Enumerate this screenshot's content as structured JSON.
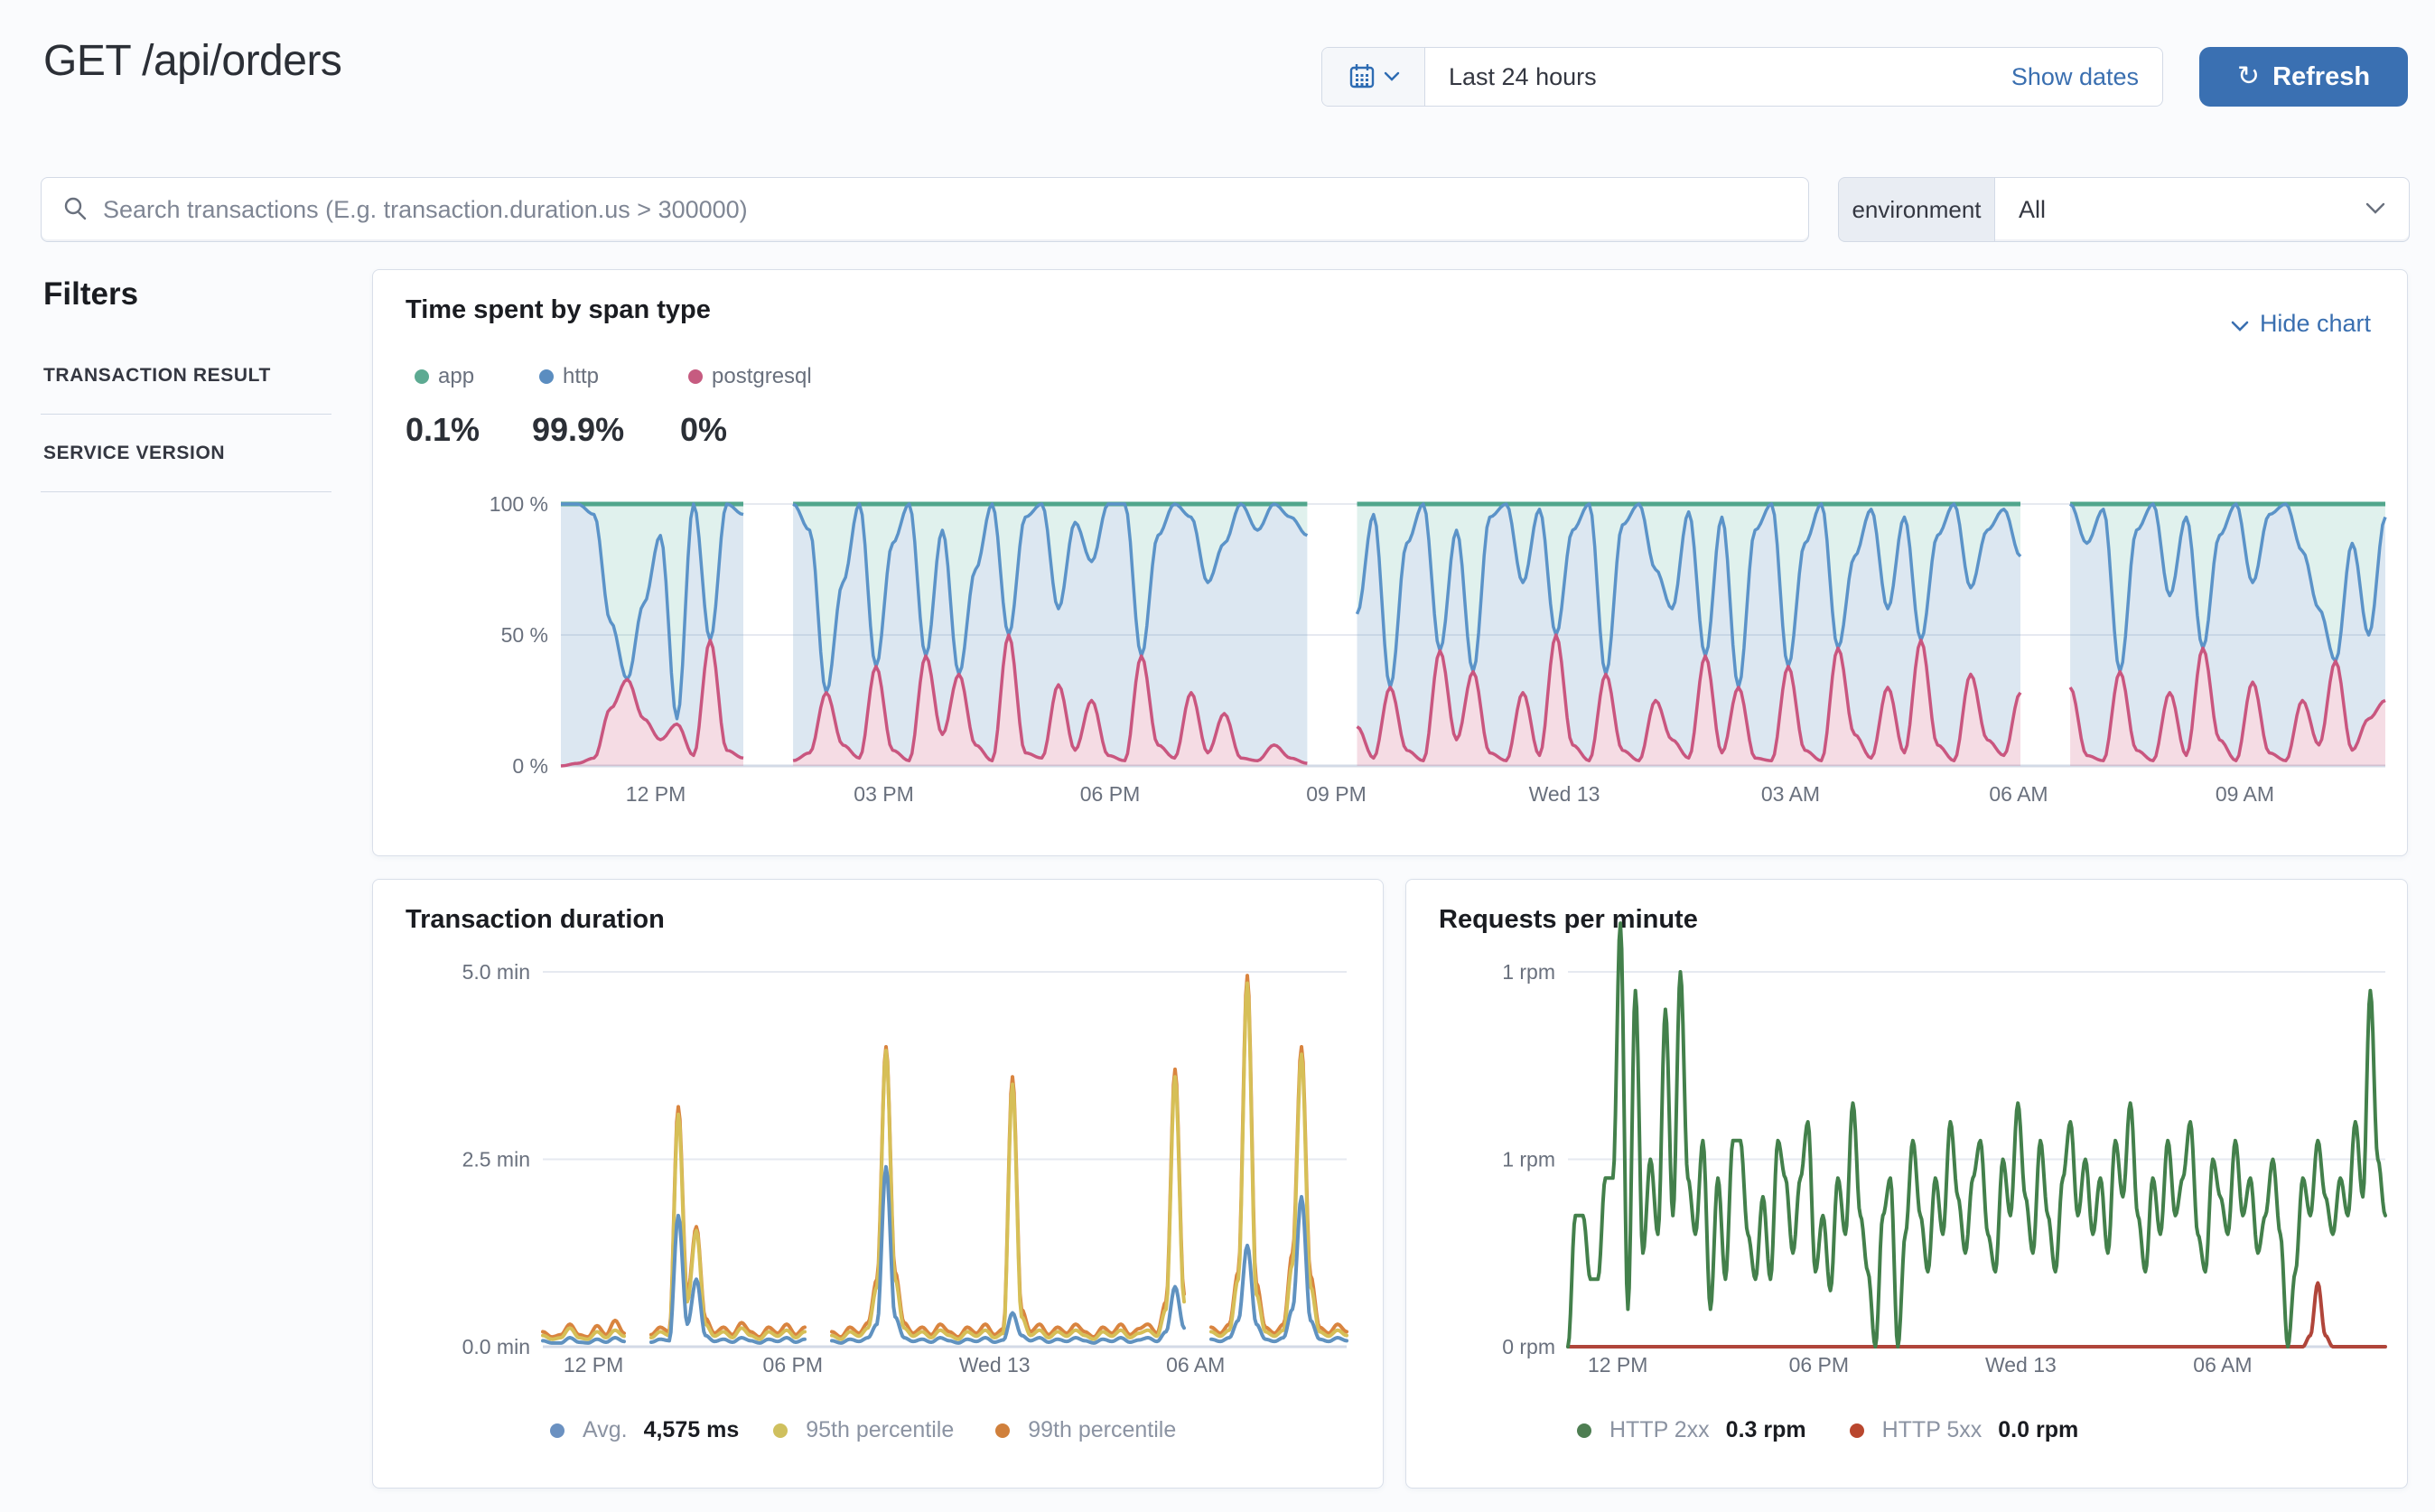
{
  "page": {
    "title": "GET /api/orders"
  },
  "datepicker": {
    "value": "Last 24 hours",
    "show_dates_label": "Show dates",
    "refresh_label": "Refresh",
    "refresh_icon_glyph": "↻",
    "accent_color": "#2e6cb3"
  },
  "search": {
    "placeholder": "Search transactions (E.g. transaction.duration.us > 300000)"
  },
  "environment": {
    "label": "environment",
    "value": "All"
  },
  "filters": {
    "title": "Filters",
    "sections": [
      {
        "label": "TRANSACTION RESULT"
      },
      {
        "label": "SERVICE VERSION"
      }
    ]
  },
  "span_card": {
    "title": "Time spent by span type",
    "hide_chart_label": "Hide chart",
    "legend": [
      {
        "label": "app",
        "pct": "0.1%",
        "color": "#5daa92"
      },
      {
        "label": "http",
        "pct": "99.9%",
        "color": "#5b8dc0"
      },
      {
        "label": "postgresql",
        "pct": "0%",
        "color": "#c65b80"
      }
    ]
  },
  "duration_card": {
    "title": "Transaction duration",
    "legend": [
      {
        "label": "Avg.",
        "value": "4,575 ms",
        "color": "#6b91c1"
      },
      {
        "label": "95th percentile",
        "value": "",
        "color": "#cfc05e"
      },
      {
        "label": "99th percentile",
        "value": "",
        "color": "#d0803c"
      }
    ]
  },
  "rpm_card": {
    "title": "Requests per minute",
    "legend": [
      {
        "label": "HTTP 2xx",
        "value": "0.3 rpm",
        "color": "#4e7e52"
      },
      {
        "label": "HTTP 5xx",
        "value": "0.0 rpm",
        "color": "#b9472e"
      }
    ]
  },
  "chart_data": [
    {
      "type": "area",
      "title": "Time spent by span type",
      "stacked_percent": true,
      "ylim": [
        0,
        100
      ],
      "grid": true,
      "yticks": [
        {
          "label": "100 %",
          "value": 100
        },
        {
          "label": "50 %",
          "value": 50
        },
        {
          "label": "0 %",
          "value": 0
        }
      ],
      "xticks": [
        {
          "label": "12 PM",
          "f": 0.052
        },
        {
          "label": "03 PM",
          "f": 0.177
        },
        {
          "label": "06 PM",
          "f": 0.301
        },
        {
          "label": "09 PM",
          "f": 0.425
        },
        {
          "label": "Wed 13",
          "f": 0.55
        },
        {
          "label": "03 AM",
          "f": 0.674
        },
        {
          "label": "06 AM",
          "f": 0.799
        },
        {
          "label": "09 AM",
          "f": 0.923
        }
      ],
      "series": [
        {
          "name": "postgresql",
          "color": "#c9567f",
          "fill": "rgba(211,96,134,0.22)",
          "values": [
            0,
            1,
            3,
            22,
            33,
            18,
            10,
            16,
            4,
            48,
            6,
            3,
            null,
            null,
            2,
            5,
            28,
            8,
            3,
            38,
            6,
            2,
            42,
            12,
            35,
            8,
            2,
            50,
            5,
            3,
            31,
            6,
            25,
            4,
            2,
            42,
            8,
            3,
            28,
            5,
            20,
            3,
            2,
            8,
            3,
            1,
            null,
            null,
            15,
            3,
            30,
            6,
            2,
            44,
            10,
            36,
            5,
            2,
            28,
            4,
            50,
            8,
            2,
            35,
            6,
            2,
            25,
            10,
            3,
            42,
            5,
            30,
            3,
            2,
            38,
            6,
            2,
            45,
            12,
            3,
            30,
            5,
            48,
            8,
            2,
            35,
            10,
            4,
            28,
            null,
            null,
            30,
            4,
            2,
            36,
            6,
            2,
            28,
            4,
            45,
            10,
            2,
            32,
            5,
            2,
            25,
            8,
            40,
            6,
            18,
            25
          ]
        },
        {
          "name": "http",
          "color": "#5b93c8",
          "fill": "rgba(96,146,192,0.22)",
          "values": [
            100,
            100,
            96,
            55,
            33,
            62,
            88,
            18,
            100,
            48,
            100,
            96,
            null,
            null,
            100,
            90,
            28,
            70,
            100,
            38,
            85,
            100,
            42,
            90,
            35,
            75,
            100,
            50,
            95,
            100,
            60,
            93,
            78,
            100,
            100,
            42,
            88,
            100,
            95,
            70,
            85,
            100,
            90,
            100,
            95,
            88,
            null,
            null,
            58,
            96,
            30,
            85,
            100,
            44,
            90,
            36,
            95,
            100,
            70,
            98,
            50,
            90,
            100,
            35,
            92,
            100,
            75,
            60,
            97,
            42,
            95,
            30,
            90,
            100,
            38,
            85,
            100,
            45,
            80,
            98,
            60,
            95,
            48,
            88,
            100,
            68,
            90,
            98,
            80,
            null,
            null,
            100,
            85,
            98,
            36,
            90,
            100,
            65,
            95,
            45,
            88,
            100,
            70,
            96,
            100,
            82,
            60,
            40,
            85,
            50,
            95
          ]
        },
        {
          "name": "app",
          "color": "#51a68c",
          "fill": "rgba(84,179,153,0.18)",
          "top_of_stack": 100
        }
      ]
    },
    {
      "type": "line",
      "title": "Transaction duration",
      "unit": "min",
      "ylim": [
        0,
        5.0
      ],
      "grid": true,
      "yticks": [
        {
          "label": "5.0 min",
          "value": 5
        },
        {
          "label": "2.5 min",
          "value": 2.5
        },
        {
          "label": "0.0 min",
          "value": 0
        }
      ],
      "xticks": [
        {
          "label": "12 PM",
          "f": 0.063
        },
        {
          "label": "06 PM",
          "f": 0.311
        },
        {
          "label": "Wed 13",
          "f": 0.562
        },
        {
          "label": "06 AM",
          "f": 0.812
        }
      ],
      "series": [
        {
          "name": "99th percentile",
          "color": "#d9843f",
          "values": [
            0.2,
            0.13,
            0.16,
            0.3,
            0.16,
            0.13,
            0.28,
            0.16,
            0.35,
            0.18,
            null,
            null,
            0.16,
            0.26,
            0.2,
            3.2,
            0.7,
            1.6,
            0.38,
            0.18,
            0.26,
            0.16,
            0.32,
            0.2,
            0.13,
            0.26,
            0.18,
            0.3,
            0.16,
            0.26,
            null,
            null,
            0.2,
            0.13,
            0.26,
            0.18,
            0.32,
            0.9,
            4.0,
            1.0,
            0.32,
            0.18,
            0.26,
            0.16,
            0.3,
            0.2,
            0.13,
            0.26,
            0.18,
            0.3,
            0.16,
            0.24,
            3.6,
            0.5,
            0.2,
            0.3,
            0.16,
            0.26,
            0.18,
            0.3,
            0.2,
            0.13,
            0.26,
            0.18,
            0.3,
            0.16,
            0.24,
            0.3,
            0.18,
            0.6,
            3.7,
            0.7,
            null,
            null,
            0.26,
            0.18,
            0.3,
            1.0,
            4.95,
            0.85,
            0.26,
            0.18,
            0.3,
            1.25,
            4.0,
            0.95,
            0.26,
            0.18,
            0.3,
            0.2
          ]
        },
        {
          "name": "95th percentile",
          "color": "#d6bf57",
          "values": [
            0.15,
            0.1,
            0.12,
            0.25,
            0.12,
            0.1,
            0.2,
            0.12,
            0.22,
            0.14,
            null,
            null,
            0.12,
            0.2,
            0.15,
            3.1,
            0.6,
            1.55,
            0.3,
            0.14,
            0.2,
            0.12,
            0.25,
            0.15,
            0.1,
            0.2,
            0.14,
            0.22,
            0.12,
            0.2,
            null,
            null,
            0.15,
            0.1,
            0.2,
            0.14,
            0.25,
            0.8,
            3.95,
            0.9,
            0.25,
            0.14,
            0.2,
            0.12,
            0.22,
            0.15,
            0.1,
            0.2,
            0.14,
            0.22,
            0.12,
            0.18,
            3.5,
            0.4,
            0.15,
            0.22,
            0.12,
            0.2,
            0.14,
            0.22,
            0.15,
            0.1,
            0.2,
            0.14,
            0.22,
            0.12,
            0.18,
            0.22,
            0.14,
            0.5,
            3.6,
            0.6,
            null,
            null,
            0.2,
            0.14,
            0.22,
            0.9,
            4.85,
            0.7,
            0.2,
            0.14,
            0.22,
            1.1,
            3.9,
            0.8,
            0.2,
            0.14,
            0.22,
            0.15
          ]
        },
        {
          "name": "Avg. 4,575 ms",
          "color": "#6092c0",
          "values": [
            0.08,
            0.05,
            0.05,
            0.12,
            0.06,
            0.05,
            0.1,
            0.06,
            0.12,
            0.07,
            null,
            null,
            0.06,
            0.1,
            0.08,
            1.75,
            0.3,
            0.9,
            0.15,
            0.07,
            0.1,
            0.06,
            0.12,
            0.08,
            0.05,
            0.1,
            0.07,
            0.12,
            0.06,
            0.1,
            null,
            null,
            0.08,
            0.05,
            0.1,
            0.07,
            0.12,
            0.3,
            2.4,
            0.4,
            0.12,
            0.07,
            0.1,
            0.06,
            0.12,
            0.08,
            0.05,
            0.1,
            0.07,
            0.12,
            0.06,
            0.09,
            0.45,
            0.15,
            0.08,
            0.12,
            0.06,
            0.1,
            0.07,
            0.12,
            0.08,
            0.05,
            0.1,
            0.07,
            0.12,
            0.06,
            0.09,
            0.12,
            0.07,
            0.2,
            0.8,
            0.25,
            null,
            null,
            0.1,
            0.07,
            0.12,
            0.35,
            1.35,
            0.3,
            0.1,
            0.07,
            0.12,
            0.5,
            2.0,
            0.35,
            0.1,
            0.07,
            0.12,
            0.08
          ]
        }
      ]
    },
    {
      "type": "line",
      "title": "Requests per minute",
      "unit": "rpm",
      "ylim": [
        0,
        1.15
      ],
      "grid": true,
      "yticks": [
        {
          "label": "1 rpm",
          "value": 1
        },
        {
          "label": "1 rpm",
          "value": 0.5
        },
        {
          "label": "0 rpm",
          "value": 0
        }
      ],
      "xticks": [
        {
          "label": "12 PM",
          "f": 0.061
        },
        {
          "label": "06 PM",
          "f": 0.307
        },
        {
          "label": "Wed 13",
          "f": 0.554
        },
        {
          "label": "06 AM",
          "f": 0.801
        }
      ],
      "series": [
        {
          "name": "HTTP 5xx",
          "color": "#b0453a",
          "avg_label": "0.0 rpm",
          "values": [
            0,
            0,
            0,
            0,
            0,
            0,
            0,
            0,
            0,
            0,
            0,
            0,
            0,
            0,
            0,
            0,
            0,
            0,
            0,
            0,
            0,
            0,
            0,
            0,
            0,
            0,
            0,
            0,
            0,
            0,
            0,
            0,
            0,
            0,
            0,
            0,
            0,
            0,
            0,
            0,
            0,
            0,
            0,
            0,
            0,
            0,
            0,
            0,
            0,
            0,
            0,
            0,
            0,
            0,
            0,
            0,
            0,
            0,
            0,
            0,
            0,
            0,
            0,
            0,
            0,
            0,
            0,
            0,
            0,
            0,
            0,
            0,
            0,
            0,
            0,
            0,
            0,
            0,
            0,
            0,
            0,
            0,
            0,
            0,
            0,
            0,
            0,
            0,
            0,
            0,
            0,
            0,
            0,
            0,
            0,
            0,
            0,
            0,
            0,
            0.03,
            0.17,
            0.03,
            0,
            0,
            0,
            0,
            0,
            0,
            0,
            0
          ]
        },
        {
          "name": "HTTP 2xx",
          "color": "#43804b",
          "avg_label": "0.3 rpm",
          "values": [
            0,
            0.35,
            0.35,
            0.18,
            0.18,
            0.45,
            0.45,
            1.13,
            0.1,
            0.95,
            0.25,
            0.5,
            0.3,
            0.9,
            0.35,
            1.0,
            0.45,
            0.3,
            0.55,
            0.1,
            0.45,
            0.18,
            0.55,
            0.55,
            0.3,
            0.18,
            0.4,
            0.18,
            0.55,
            0.45,
            0.25,
            0.45,
            0.6,
            0.2,
            0.35,
            0.15,
            0.45,
            0.3,
            0.65,
            0.35,
            0.2,
            0,
            0.35,
            0.45,
            0,
            0.3,
            0.55,
            0.35,
            0.2,
            0.45,
            0.3,
            0.6,
            0.4,
            0.25,
            0.45,
            0.55,
            0.3,
            0.2,
            0.5,
            0.35,
            0.65,
            0.4,
            0.25,
            0.55,
            0.35,
            0.2,
            0.45,
            0.6,
            0.35,
            0.5,
            0.3,
            0.45,
            0.25,
            0.55,
            0.4,
            0.65,
            0.35,
            0.2,
            0.45,
            0.3,
            0.55,
            0.35,
            0.45,
            0.6,
            0.3,
            0.2,
            0.5,
            0.4,
            0.3,
            0.55,
            0.35,
            0.45,
            0.25,
            0.35,
            0.5,
            0.3,
            0,
            0.2,
            0.45,
            0.35,
            0.55,
            0.4,
            0.3,
            0.45,
            0.35,
            0.6,
            0.4,
            0.95,
            0.5,
            0.35
          ]
        }
      ]
    }
  ]
}
